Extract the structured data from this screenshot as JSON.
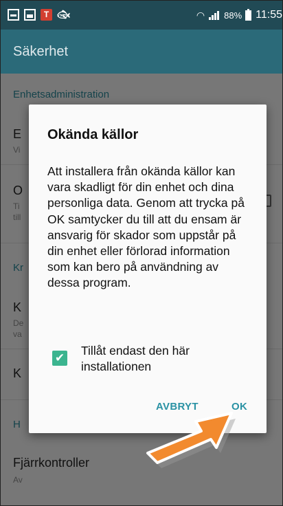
{
  "status_bar": {
    "icons": [
      "notification-square-icon",
      "gallery-icon",
      "t-app-icon",
      "fish-app-icon",
      "wifi-icon",
      "signal-icon"
    ],
    "battery_text": "88%",
    "time": "11:55"
  },
  "app_bar": {
    "title": "Säkerhet"
  },
  "background_list": {
    "section1_header": "Enhetsadministration",
    "item1_title": "E",
    "item1_sub": "Vi",
    "item2_title": "O",
    "item2_sub_line1": "Ti",
    "item2_sub_line2": "till",
    "section2_header": "Kr",
    "item3_title": "K",
    "item3_sub_line1": "De",
    "item3_sub_line2": "va",
    "item4_title": "K",
    "section3_header": "H",
    "item5_title": "Fjärrkontroller",
    "item5_sub": "Av"
  },
  "dialog": {
    "title": "Okända källor",
    "message": "Att installera från okända källor kan vara skadligt för din enhet och dina personliga data. Genom att trycka på OK samtycker du till att du ensam är ansvarig för skador som uppstår på din enhet eller förlorad information som kan bero på användning av dessa program.",
    "checkbox_label": "Tillåt endast den här installationen",
    "checkbox_checked": true,
    "cancel_label": "AVBRYT",
    "ok_label": "OK"
  },
  "colors": {
    "status_bar": "#214a55",
    "app_bar": "#2b6a79",
    "accent": "#2a92a4",
    "checkbox": "#3bb48f",
    "arrow": "#f28a2e"
  }
}
